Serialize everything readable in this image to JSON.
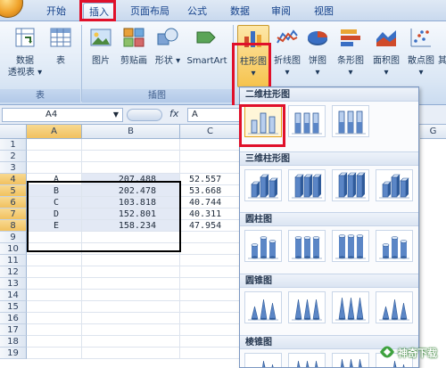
{
  "ribbon_tabs": [
    "开始",
    "插入",
    "页面布局",
    "公式",
    "数据",
    "审阅",
    "视图"
  ],
  "groups": {
    "table": {
      "label": "表",
      "pivot_label_line1": "数据",
      "pivot_label_line2": "透视表",
      "table_label": "表"
    },
    "illustrations": {
      "label": "插图",
      "picture": "图片",
      "clipart": "剪贴画",
      "shapes": "形状",
      "smartart": "SmartArt"
    },
    "charts": {
      "column": "柱形图",
      "line": "折线图",
      "pie": "饼图",
      "bar": "条形图",
      "area": "面积图",
      "scatter": "散点图",
      "other_partial": "其"
    }
  },
  "formula_bar": {
    "name_box": "A4",
    "fx": "fx",
    "formula_value": "A"
  },
  "columns": [
    "A",
    "B",
    "C"
  ],
  "right_column": "G",
  "rows": [
    "1",
    "2",
    "3",
    "4",
    "5",
    "6",
    "7",
    "8",
    "9",
    "10",
    "11",
    "12",
    "13",
    "14",
    "15",
    "16",
    "17",
    "18",
    "19"
  ],
  "data": [
    {
      "a": "A",
      "b": "207.488",
      "c": "52.557"
    },
    {
      "a": "B",
      "b": "202.478",
      "c": "53.668"
    },
    {
      "a": "C",
      "b": "103.818",
      "c": "40.744"
    },
    {
      "a": "D",
      "b": "152.801",
      "c": "40.311"
    },
    {
      "a": "E",
      "b": "158.234",
      "c": "47.954"
    }
  ],
  "gallery_sections": [
    "二维柱形图",
    "三维柱形图",
    "圆柱图",
    "圆锥图",
    "棱锥图"
  ],
  "watermark": "神奇下载",
  "colors": {
    "accent_red": "#e0102a",
    "ribbon_blue": "#dbe7f5",
    "selection_gold": "#f1c15f"
  }
}
